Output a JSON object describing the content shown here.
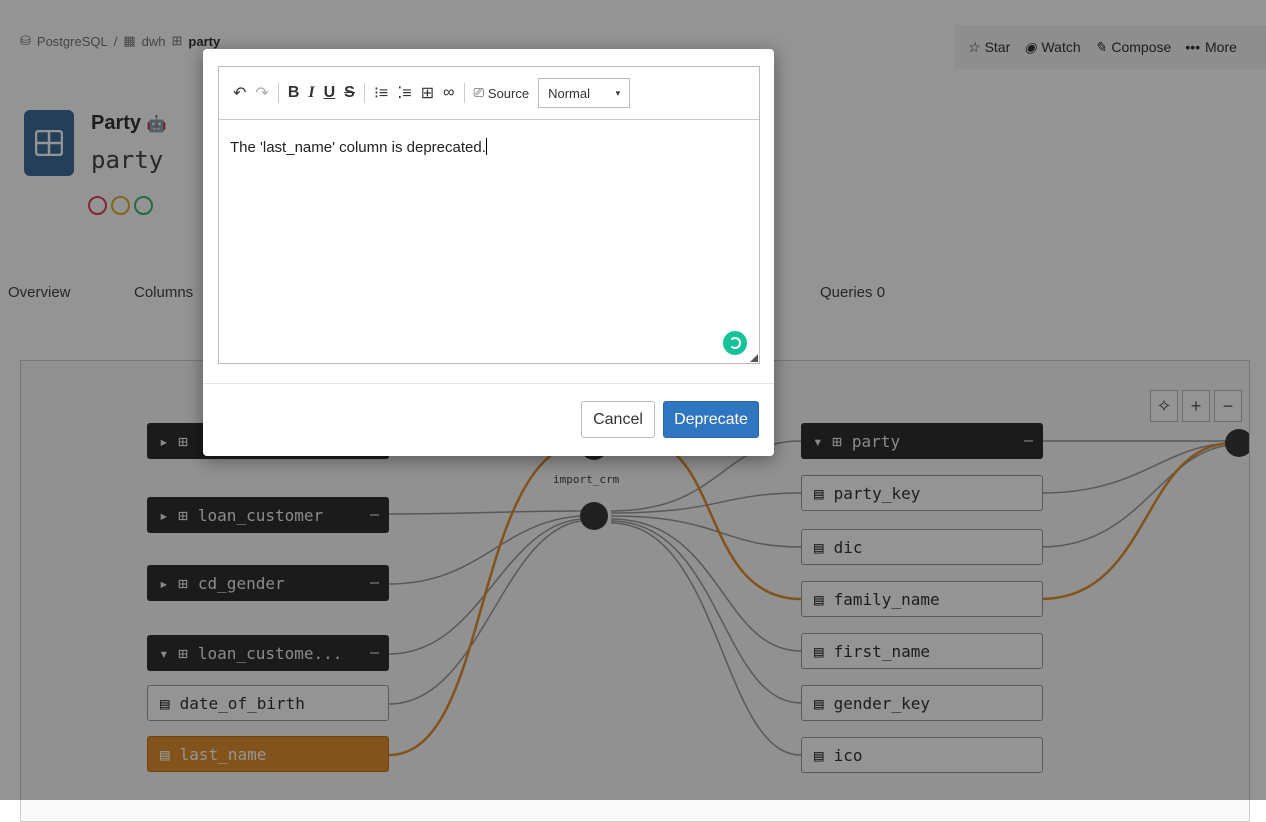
{
  "breadcrumb": {
    "db": "PostgreSQL",
    "sep": "/",
    "schema": "dwh",
    "table": "party"
  },
  "header_actions": [
    {
      "icon": "star-icon",
      "label": "Star"
    },
    {
      "icon": "eye-icon",
      "label": "Watch"
    },
    {
      "icon": "pen-icon",
      "label": "Compose"
    },
    {
      "icon": "ellipsis-icon",
      "label": "More"
    }
  ],
  "entity": {
    "title": "Party",
    "subtitle": "party",
    "circle_colors": [
      "#e0445a",
      "#e0b030",
      "#3cb87a"
    ]
  },
  "tabs": {
    "overview": "Overview",
    "columns": "Columns",
    "queries": "Queries 0"
  },
  "lineage": {
    "left_nodes": [
      "loan_customer",
      "cd_gender",
      "loan_custome...",
      "date_of_birth",
      "last_name"
    ],
    "process_label": "import_crm",
    "right_nodes": [
      "party",
      "party_key",
      "dic",
      "family_name",
      "first_name",
      "gender_key",
      "ico"
    ],
    "dash": "—"
  },
  "editor": {
    "text": "The 'last_name' column is deprecated.",
    "source_label": "Source",
    "format_value": "Normal"
  },
  "buttons": {
    "cancel": "Cancel",
    "deprecate": "Deprecate"
  },
  "colors": {
    "primary": "#2f75c0",
    "highlight": "#e0902e",
    "dark_node": "#303030"
  }
}
